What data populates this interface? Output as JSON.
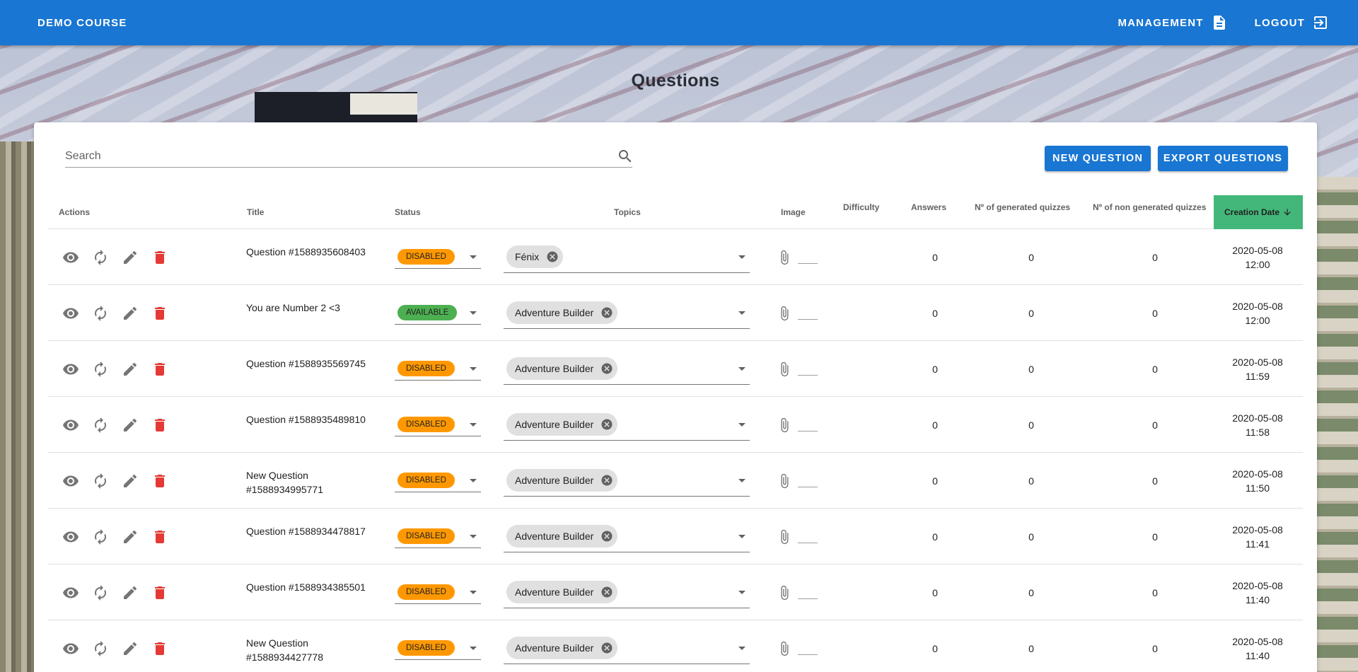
{
  "app": {
    "brand": "DEMO COURSE",
    "nav": [
      {
        "label": "MANAGEMENT",
        "icon": "file-document-icon"
      },
      {
        "label": "LOGOUT",
        "icon": "logout-icon"
      }
    ],
    "accent": "#1976d2"
  },
  "page": {
    "title": "Questions",
    "search_placeholder": "Search",
    "buttons": {
      "new_question": "NEW QUESTION",
      "export_questions": "EXPORT QUESTIONS"
    }
  },
  "table": {
    "headers": {
      "actions": "Actions",
      "title": "Title",
      "status": "Status",
      "topics": "Topics",
      "image": "Image",
      "difficulty": "Difficulty",
      "answers": "Answers",
      "generated": "Nº of generated quizzes",
      "non_generated": "Nº of non generated quizzes",
      "creation_date": "Creation Date"
    },
    "sorted_column": "Creation Date",
    "sort_direction": "descending",
    "status_colors": {
      "DISABLED": "#ff9800",
      "AVAILABLE": "#4caf50"
    },
    "rows": [
      {
        "title": "Question #1588935608403",
        "status": "DISABLED",
        "topic": "Fénix",
        "answers": "0",
        "generated": "0",
        "non_generated": "0",
        "date": "2020-05-08",
        "time": "12:00"
      },
      {
        "title": "You are Number 2 <3",
        "status": "AVAILABLE",
        "topic": "Adventure Builder",
        "answers": "0",
        "generated": "0",
        "non_generated": "0",
        "date": "2020-05-08",
        "time": "12:00"
      },
      {
        "title": "Question #1588935569745",
        "status": "DISABLED",
        "topic": "Adventure Builder",
        "answers": "0",
        "generated": "0",
        "non_generated": "0",
        "date": "2020-05-08",
        "time": "11:59"
      },
      {
        "title": "Question #1588935489810",
        "status": "DISABLED",
        "topic": "Adventure Builder",
        "answers": "0",
        "generated": "0",
        "non_generated": "0",
        "date": "2020-05-08",
        "time": "11:58"
      },
      {
        "title": "New Question #1588934995771",
        "status": "DISABLED",
        "topic": "Adventure Builder",
        "answers": "0",
        "generated": "0",
        "non_generated": "0",
        "date": "2020-05-08",
        "time": "11:50"
      },
      {
        "title": "Question #1588934478817",
        "status": "DISABLED",
        "topic": "Adventure Builder",
        "answers": "0",
        "generated": "0",
        "non_generated": "0",
        "date": "2020-05-08",
        "time": "11:41"
      },
      {
        "title": "Question #1588934385501",
        "status": "DISABLED",
        "topic": "Adventure Builder",
        "answers": "0",
        "generated": "0",
        "non_generated": "0",
        "date": "2020-05-08",
        "time": "11:40"
      },
      {
        "title": "New Question #1588934427778",
        "status": "DISABLED",
        "topic": "Adventure Builder",
        "answers": "0",
        "generated": "0",
        "non_generated": "0",
        "date": "2020-05-08",
        "time": "11:40"
      }
    ]
  }
}
